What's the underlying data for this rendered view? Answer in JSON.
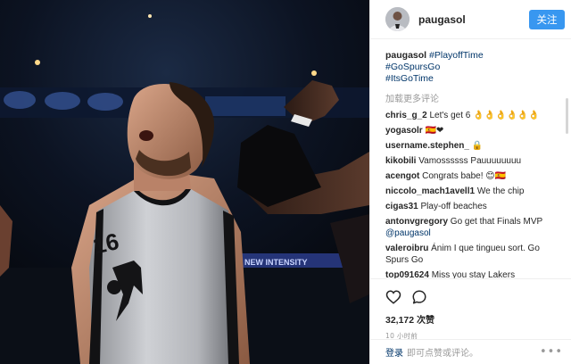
{
  "post": {
    "username": "paugasol",
    "follow_label": "关注",
    "caption": {
      "username": "paugasol",
      "hashtags": [
        "#PlayoffTime",
        "#GoSpursGo",
        "#ItsGoTime"
      ]
    },
    "load_more": "加载更多评论",
    "comments": [
      {
        "user": "chris_g_2",
        "text": "Let's get 6 👌👌👌👌👌👌"
      },
      {
        "user": "yogasolr",
        "text": "🇪🇸❤"
      },
      {
        "user": "username.stephen_",
        "text": "🔒"
      },
      {
        "user": "kikobili",
        "text": "Vamossssss Pauuuuuuuu"
      },
      {
        "user": "acengot",
        "text": "Congrats babe! 😊🇪🇸"
      },
      {
        "user": "niccolo_mach1avell1",
        "text": "We the chip"
      },
      {
        "user": "cigas31",
        "text": "Play-off beaches"
      },
      {
        "user": "antonvgregory",
        "text": "Go get that Finals MVP",
        "mention": "@paugasol"
      },
      {
        "user": "valeroibru",
        "text": "Ánim I que tingueu sort. Go Spurs Go"
      },
      {
        "user": "top091624",
        "text": "Miss you stay Lakers"
      }
    ],
    "likes_count": "32,172",
    "likes_unit": "次赞",
    "timestamp": "10 小时前",
    "login_link": "登录",
    "login_hint": "即可点赞或评论。",
    "more_icon": "•••"
  },
  "photo": {
    "jersey_number": "16",
    "banner_text": "NEW INTENSITY"
  },
  "colors": {
    "accent": "#3897f0",
    "link": "#003569",
    "muted": "#999999"
  },
  "icons": [
    "heart-icon",
    "comment-icon",
    "more-options-icon"
  ]
}
